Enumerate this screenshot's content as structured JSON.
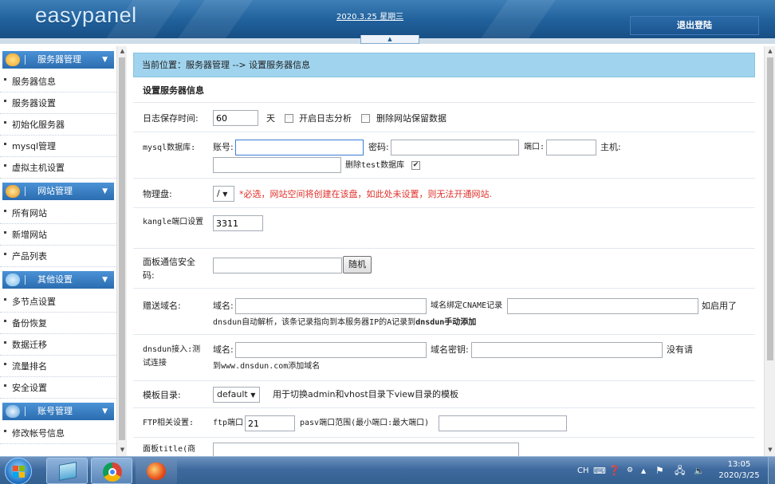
{
  "header": {
    "logo": "easypanel",
    "date": "2020.3.25 星期三",
    "logout": "退出登陆"
  },
  "sidebar": {
    "sections": [
      {
        "title": "服务器管理",
        "items": [
          "服务器信息",
          "服务器设置",
          "初始化服务器",
          "mysql管理",
          "虚拟主机设置"
        ]
      },
      {
        "title": "网站管理",
        "items": [
          "所有网站",
          "新增网站",
          "产品列表"
        ]
      },
      {
        "title": "其他设置",
        "items": [
          "多节点设置",
          "备份恢复",
          "数据迁移",
          "流量排名",
          "安全设置"
        ]
      },
      {
        "title": "账号管理",
        "items": [
          "修改帐号信息"
        ]
      }
    ]
  },
  "main": {
    "breadcrumb": "当前位置：服务器管理 --> 设置服务器信息",
    "form_title": "设置服务器信息",
    "log": {
      "label": "日志保存时间:",
      "value": "60",
      "unit": "天",
      "enable_analysis": "开启日志分析",
      "delete_site_keep": "删除网站保留数据"
    },
    "mysql": {
      "label": "mysql数据库:",
      "account_label": "账号:",
      "account_value": "",
      "password_label": "密码:",
      "port_label": "端口:",
      "host_label": "主机:",
      "delete_test": "删除test数据库"
    },
    "disk": {
      "label": "物理盘:",
      "selected": "/",
      "hint": "*必选，网站空间将创建在该盘，如此处未设置，则无法开通网站."
    },
    "kangle": {
      "label": "kangle端口设置",
      "value": "3311"
    },
    "panel_sec": {
      "label": "面板通信安全码:",
      "value": "",
      "random": "随机"
    },
    "gift_domain": {
      "label": "赠送域名:",
      "domain_label": "域名:",
      "cname_label": "域名绑定CNAME记录",
      "suffix": "如启用了",
      "line2_a": "dnsdun自动解析，该条记录指向到本服务器IP的A记录到",
      "line2_b": "dnsdun手动添加"
    },
    "dnsdun": {
      "label": "dnsdun接入:测试连接",
      "domain_label": "域名:",
      "key_label": "域名密钥:",
      "suffix": "没有请",
      "line2": "到www.dnsdun.com添加域名"
    },
    "template": {
      "label": "模板目录:",
      "selected": "default",
      "hint": "用于切换admin和vhost目录下view目录的模板"
    },
    "ftp": {
      "label": "FTP相关设置:",
      "port_label": "ftp端口",
      "port_value": "21",
      "pasv_label": "pasv端口范围(最小端口:最大端口)"
    },
    "panel_title": {
      "label": "面板title(商"
    }
  },
  "taskbar": {
    "lang": "CH",
    "time": "13:05",
    "date": "2020/3/25"
  },
  "colors": {
    "header": "#20609a",
    "sidebar_head": "#3a7fc4",
    "breadcrumb_bg": "#9fd3ee",
    "hint_red": "#e0302a"
  }
}
